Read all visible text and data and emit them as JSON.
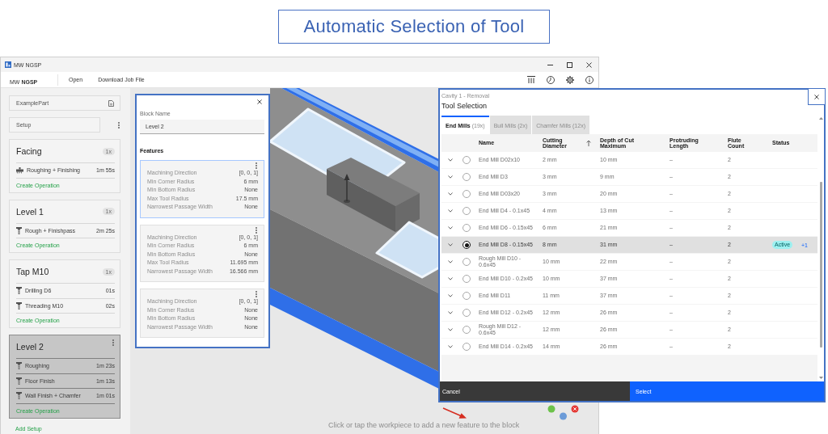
{
  "slide_title": "Automatic Selection of Tool",
  "window": {
    "title": "MW NGSP"
  },
  "app_bar": {
    "brand": "MW **NGSP**",
    "menu": [
      "Open",
      "Download Job File"
    ]
  },
  "sidebar": {
    "part": "ExamplePart",
    "setup": "Setup",
    "blocks": [
      {
        "title": "Facing",
        "count": "1x",
        "selected": false,
        "operations": [
          {
            "name": "Roughing + Finishing",
            "time": "1m 55s",
            "kind": "facing"
          }
        ],
        "action": "Create Operation"
      },
      {
        "title": "Level 1",
        "count": "1x",
        "selected": false,
        "operations": [
          {
            "name": "Rough + Finishpass",
            "time": "2m 25s",
            "kind": "milling"
          }
        ],
        "action": "Create Operation"
      },
      {
        "title": "Tap M10",
        "count": "1x",
        "selected": false,
        "operations": [
          {
            "name": "Drilling D6",
            "time": "01s",
            "kind": "milling"
          },
          {
            "name": "Threading M10",
            "time": "02s",
            "kind": "milling"
          }
        ],
        "action": "Create Operation"
      },
      {
        "title": "Level 2",
        "selected": true,
        "operations": [
          {
            "name": "Roughing",
            "time": "1m 23s",
            "kind": "milling"
          },
          {
            "name": "Floor Finish",
            "time": "1m 13s",
            "kind": "milling"
          },
          {
            "name": "Wall Finish + Chamfer",
            "time": "1m 01s",
            "kind": "milling"
          }
        ],
        "action": "Create Operation"
      }
    ],
    "add_setup": "Add Setup"
  },
  "block_panel": {
    "label": "Block Name",
    "value": "Level 2",
    "features_heading": "Features",
    "features": [
      {
        "selected": true,
        "properties": [
          {
            "label": "Machining Direction",
            "value": "[0, 0, 1]"
          },
          {
            "label": "Min Corner Radius",
            "value": "6 mm"
          },
          {
            "label": "Min Bottom Radius",
            "value": "None"
          },
          {
            "label": "Max Tool Radius",
            "value": "17.5 mm"
          },
          {
            "label": "Narrowest Passage Width",
            "value": "None"
          }
        ]
      },
      {
        "selected": false,
        "properties": [
          {
            "label": "Machining Direction",
            "value": "[0, 0, 1]"
          },
          {
            "label": "Min Corner Radius",
            "value": "6 mm"
          },
          {
            "label": "Min Bottom Radius",
            "value": "None"
          },
          {
            "label": "Max Tool Radius",
            "value": "11.695 mm"
          },
          {
            "label": "Narrowest Passage Width",
            "value": "16.566 mm"
          }
        ]
      },
      {
        "selected": false,
        "properties": [
          {
            "label": "Machining Direction",
            "value": "[0, 0, 1]"
          },
          {
            "label": "Min Corner Radius",
            "value": "None"
          },
          {
            "label": "Min Bottom Radius",
            "value": "None"
          },
          {
            "label": "Narrowest Passage Width",
            "value": "None"
          }
        ]
      }
    ]
  },
  "viewport": {
    "hint": "Click or tap the workpiece to add a new feature to the block"
  },
  "tool_selection": {
    "subtitle": "Cavity 1 - Removal",
    "title": "Tool Selection",
    "tabs": [
      {
        "label": "End Mills",
        "count": "(19x)",
        "selected": true
      },
      {
        "label": "Bull Mills",
        "count": "(2x)",
        "selected": false
      },
      {
        "label": "Chamfer Mills",
        "count": "(12x)",
        "selected": false
      }
    ],
    "columns": [
      {
        "label": "Name",
        "sorted": false
      },
      {
        "label": "Cutting Diameter",
        "sorted": true
      },
      {
        "label": "Depth of Cut Maximum",
        "sorted": false
      },
      {
        "label": "Protruding Length",
        "sorted": false
      },
      {
        "label": "Flute Count",
        "sorted": false
      },
      {
        "label": "Status",
        "sorted": false
      }
    ],
    "rows": [
      {
        "cells": [
          "End Mill D02x10",
          "2 mm",
          "10 mm",
          "–",
          "2"
        ],
        "selected": false
      },
      {
        "cells": [
          "End Mill D3",
          "3 mm",
          "9 mm",
          "–",
          "2"
        ],
        "selected": false
      },
      {
        "cells": [
          "End Mill D03x20",
          "3 mm",
          "20 mm",
          "–",
          "2"
        ],
        "selected": false
      },
      {
        "cells": [
          "End Mill D4 - 0.1x45",
          "4 mm",
          "13 mm",
          "–",
          "2"
        ],
        "selected": false
      },
      {
        "cells": [
          "End Mill D6 - 0.15x45",
          "6 mm",
          "21 mm",
          "–",
          "2"
        ],
        "selected": false
      },
      {
        "cells": [
          "End Mill D8 - 0.15x45",
          "8 mm",
          "31 mm",
          "–",
          "2"
        ],
        "selected": true,
        "status": "Active",
        "extra": "+1"
      },
      {
        "cells": [
          "Rough Mill D10 - 0.6x45",
          "10 mm",
          "22 mm",
          "–",
          "2"
        ],
        "selected": false
      },
      {
        "cells": [
          "End Mill D10 - 0.2x45",
          "10 mm",
          "37 mm",
          "–",
          "2"
        ],
        "selected": false
      },
      {
        "cells": [
          "End Mill D11",
          "11 mm",
          "37 mm",
          "–",
          "2"
        ],
        "selected": false
      },
      {
        "cells": [
          "End Mill D12 - 0.2x45",
          "12 mm",
          "26 mm",
          "–",
          "2"
        ],
        "selected": false
      },
      {
        "cells": [
          "Rough Mill D12 - 0.6x45",
          "12 mm",
          "26 mm",
          "–",
          "2"
        ],
        "selected": false
      },
      {
        "cells": [
          "End Mill D14 - 0.2x45",
          "14 mm",
          "26 mm",
          "–",
          "2"
        ],
        "selected": false
      }
    ],
    "cancel": "Cancel",
    "select": "Select"
  }
}
